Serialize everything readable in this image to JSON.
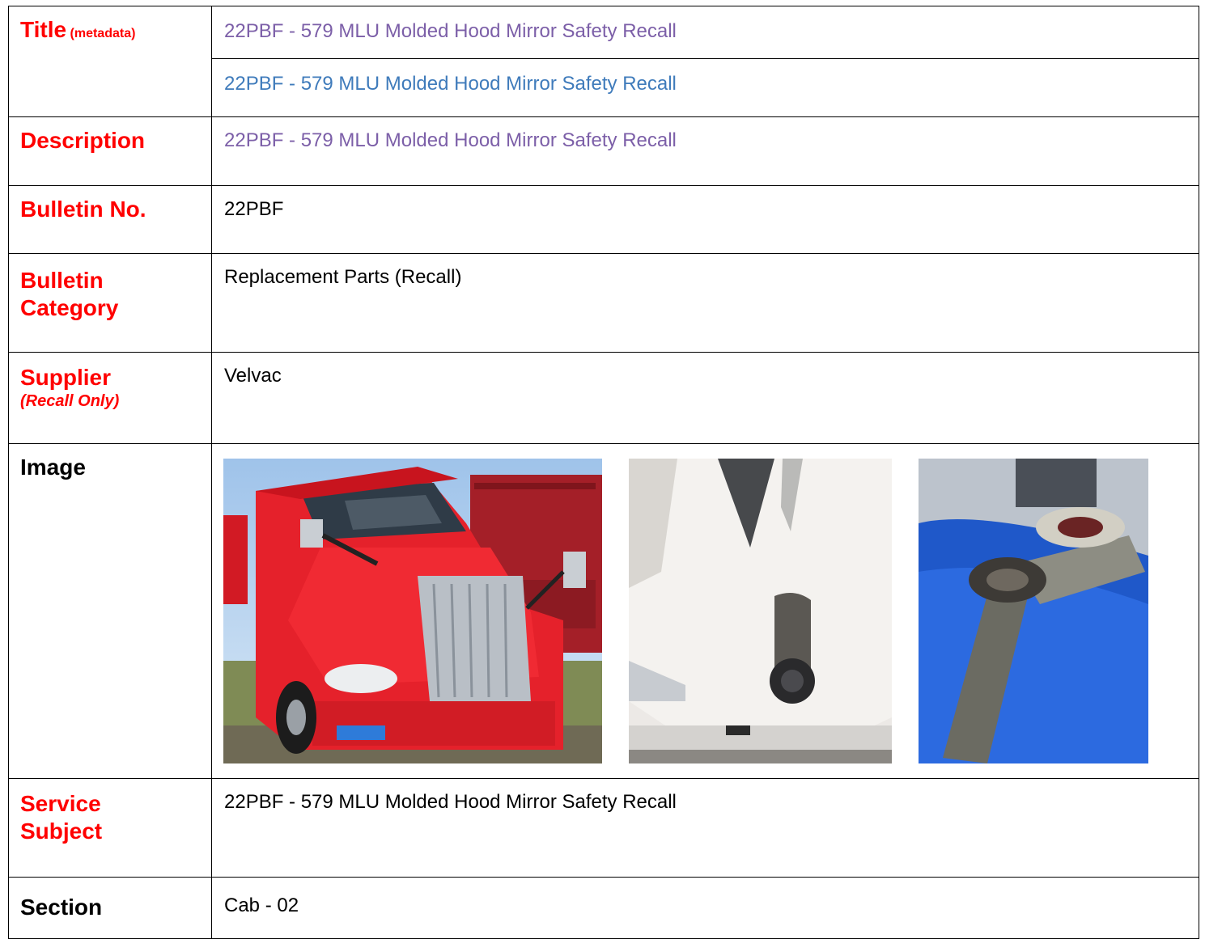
{
  "rows": {
    "title": {
      "label": "Title",
      "note": "(metadata)",
      "value1": "22PBF - 579 MLU Molded Hood Mirror Safety Recall",
      "value2": "22PBF - 579 MLU Molded Hood Mirror Safety Recall"
    },
    "description": {
      "label": "Description",
      "value": "22PBF - 579 MLU Molded Hood Mirror Safety Recall"
    },
    "bulletin_no": {
      "label": "Bulletin No.",
      "value": "22PBF"
    },
    "bulletin_category": {
      "label_line1": "Bulletin",
      "label_line2": "Category",
      "value": "Replacement Parts (Recall)"
    },
    "supplier": {
      "label": "Supplier",
      "note": "(Recall Only)",
      "value": "Velvac"
    },
    "image": {
      "label": "Image",
      "photos": [
        "red-truck-photo",
        "white-hood-mirror-base-photo",
        "broken-mirror-arm-photo"
      ]
    },
    "service_subject": {
      "label_line1": "Service",
      "label_line2": "Subject",
      "value": "22PBF - 579 MLU Molded Hood Mirror Safety Recall"
    },
    "section": {
      "label": "Section",
      "value": "Cab - 02"
    }
  },
  "colors": {
    "label_red": "#ff0000",
    "metadata_purple": "#7c5fa8",
    "metadata_blue": "#3f7bbb"
  }
}
